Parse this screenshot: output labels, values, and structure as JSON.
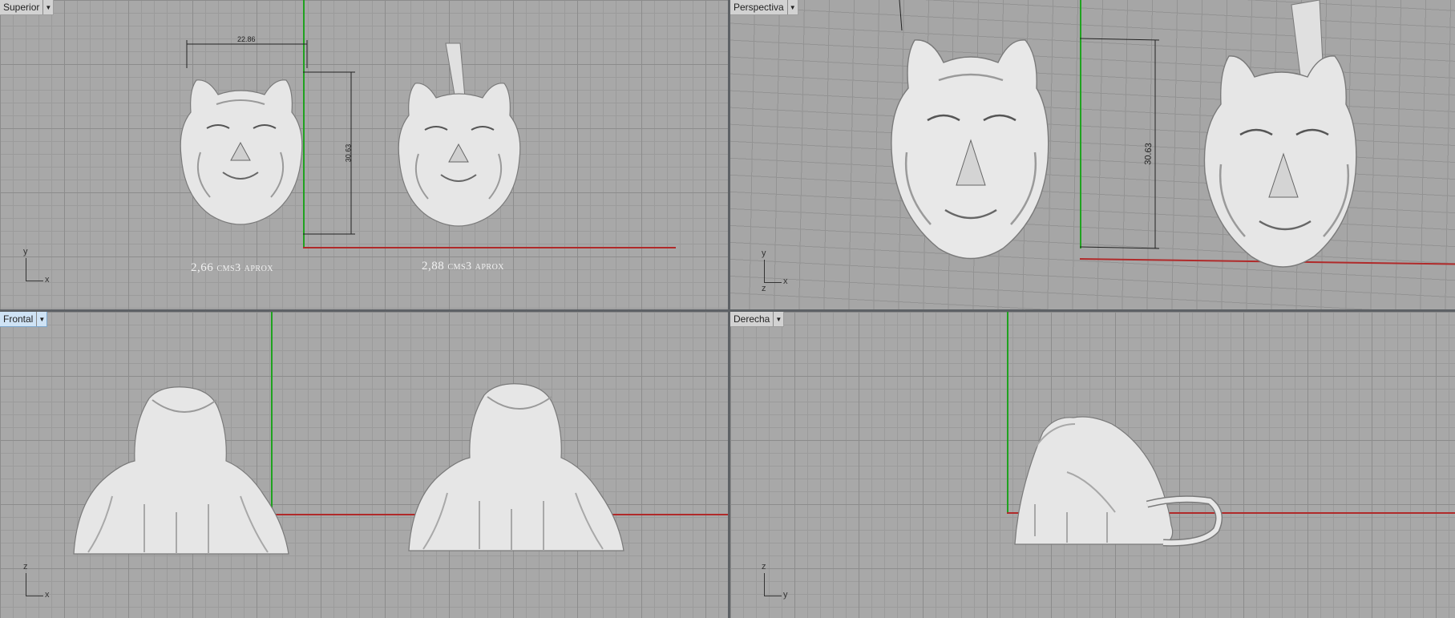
{
  "viewports": {
    "top": {
      "label": "Superior",
      "dim_width": "22.86",
      "dim_height": "30.63",
      "caption_left_num": "2,66",
      "caption_left_unit": "cms3 aprox",
      "caption_right_num": "2,88",
      "caption_right_unit": "cms3 aprox",
      "axis_y": "y",
      "axis_x": "x"
    },
    "perspective": {
      "label": "Perspectiva",
      "dim_height": "30.63",
      "axis_y": "y",
      "axis_x": "x",
      "axis_z": "z"
    },
    "front": {
      "label": "Frontal",
      "axis_z": "z",
      "axis_x": "x"
    },
    "right": {
      "label": "Derecha",
      "axis_z": "z",
      "axis_y": "y"
    }
  },
  "dropdown_glyph": "▼",
  "colors": {
    "x_axis": "#b02a2a",
    "y_axis": "#1fa21f",
    "active_label": "#cfe3f5",
    "model": "#e6e6e6"
  }
}
